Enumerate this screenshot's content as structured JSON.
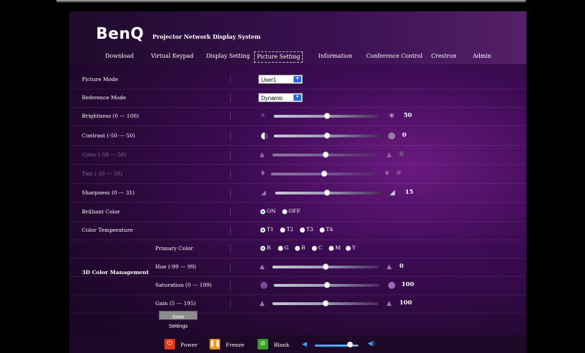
{
  "header": {
    "logo": "BenQ",
    "subtitle": "Projector Network Display System"
  },
  "nav": {
    "download": "Download",
    "virtual_keypad": "Virtual Keypad",
    "display_setting": "Display Setting",
    "picture_setting": "Picture Setting",
    "information": "Information",
    "conference_control": "Conference Control",
    "crestron": "Crestron",
    "admin": "Admin",
    "active": "picture_setting"
  },
  "settings": {
    "picture_mode": {
      "label": "Picture Mode",
      "value": "User1"
    },
    "reference_mode": {
      "label": "Reference Mode",
      "value": "Dynamic"
    },
    "brightness": {
      "label": "Brightness (0 --- 100)",
      "value": "50",
      "min": 0,
      "max": 100,
      "level": 50
    },
    "contrast": {
      "label": "Contrast (-50 --- 50)",
      "value": "0",
      "min": -50,
      "max": 50,
      "level": 0
    },
    "color": {
      "label": "Color (-50 --- 50)",
      "value": "0",
      "min": -50,
      "max": 50,
      "level": 0,
      "disabled": true
    },
    "tint": {
      "label": "Tint (-50 --- 50)",
      "value": "0",
      "min": -50,
      "max": 50,
      "level": 0,
      "disabled": true
    },
    "sharpness": {
      "label": "Sharpness (0 --- 31)",
      "value": "15",
      "min": 0,
      "max": 31,
      "level": 15
    },
    "brilliant_color": {
      "label": "Brilliant Color",
      "options": [
        "ON",
        "OFF"
      ],
      "selected": "ON"
    },
    "color_temperature": {
      "label": "Color Temperature",
      "options": [
        "T1",
        "T2",
        "T3",
        "T4"
      ],
      "selected": "T1"
    }
  },
  "color_management": {
    "label": "3D Color Management",
    "primary_color": {
      "label": "Primary Color",
      "options": [
        "R",
        "G",
        "B",
        "C",
        "M",
        "Y"
      ],
      "selected": "R"
    },
    "hue": {
      "label": "Hue (-99 --- 99)",
      "value": "0",
      "min": -99,
      "max": 99,
      "level": 0
    },
    "saturation": {
      "label": "Saturation (0 --- 199)",
      "value": "100",
      "min": 0,
      "max": 199,
      "level": 100
    },
    "gain": {
      "label": "Gain (5 --- 195)",
      "value": "100",
      "min": 5,
      "max": 195,
      "level": 100
    }
  },
  "save_button": "Save Settings",
  "footer": {
    "power": "Power",
    "freeze": "Freeze",
    "blank": "Blank",
    "volume_level": 0.8,
    "colors": {
      "power": "#e03a1e",
      "freeze": "#f09a12",
      "blank": "#3aa12a",
      "volume": "#3fa5ff"
    }
  }
}
